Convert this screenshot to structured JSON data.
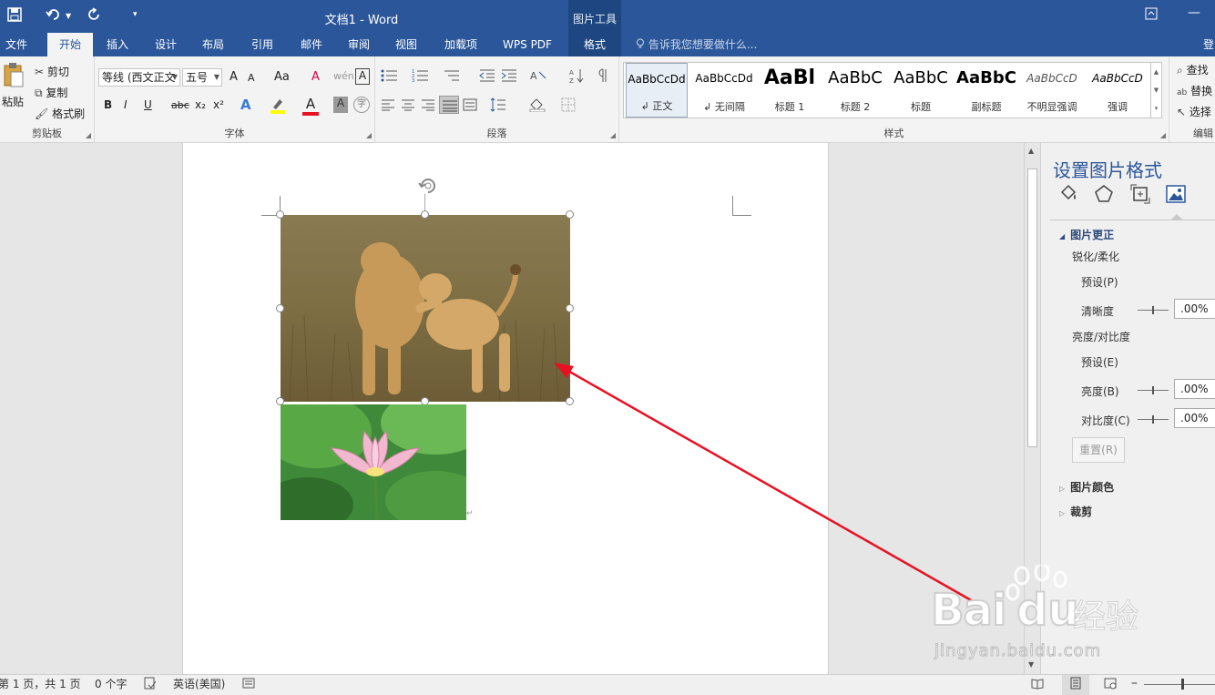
{
  "window": {
    "title": "文档1 - Word",
    "context_title": "图片工具",
    "restore_icon": "ribbon-display-icon",
    "minimize_glyph": "—"
  },
  "tabs": [
    "文件",
    "开始",
    "插入",
    "设计",
    "布局",
    "引用",
    "邮件",
    "审阅",
    "视图",
    "加载项",
    "WPS PDF",
    "格式"
  ],
  "active_tab": "开始",
  "tell_me": "告诉我您想要做什么...",
  "signin_partial": "登",
  "ribbon": {
    "clipboard": {
      "label": "剪贴板",
      "paste": "粘贴",
      "cut": "剪切",
      "copy": "复制",
      "format_painter": "格式刷"
    },
    "font": {
      "label": "字体",
      "font_name": "等线 (西文正文",
      "font_size": "五号",
      "bold": "B",
      "italic": "I",
      "underline": "U",
      "strike": "abc",
      "subscript": "x₂",
      "superscript": "x²",
      "grow": "A",
      "shrink": "A",
      "case": "Aa",
      "clear_format": "A",
      "phonetic": "wén",
      "border_char": "A",
      "text_effect": "A",
      "font_color": "A",
      "shading": "A",
      "enclose": "字",
      "highlight_color": "#ffff00",
      "font_color_value": "#e81123"
    },
    "paragraph": {
      "label": "段落"
    },
    "styles": {
      "label": "样式",
      "items": [
        {
          "sample": "AaBbCcDd",
          "name": "↲ 正文"
        },
        {
          "sample": "AaBbCcDd",
          "name": "↲ 无间隔"
        },
        {
          "sample": "AaBl",
          "name": "标题 1"
        },
        {
          "sample": "AaBbC",
          "name": "标题 2"
        },
        {
          "sample": "AaBbC",
          "name": "标题"
        },
        {
          "sample": "AaBbC",
          "name": "副标题"
        },
        {
          "sample": "AaBbCcD",
          "name": "不明显强调"
        },
        {
          "sample": "AaBbCcD",
          "name": "强调"
        }
      ]
    },
    "editing": {
      "label": "编辑",
      "find": "查找",
      "replace": "替换",
      "select": "选择"
    }
  },
  "pane": {
    "title": "设置图片格式",
    "tabs": [
      "fill-line-icon",
      "effects-icon",
      "layout-size-icon",
      "picture-icon"
    ],
    "section_correction": "图片更正",
    "sharpen_soften": "锐化/柔化",
    "preset1": "预设(P)",
    "sharpness": "清晰度",
    "sharpness_value": ".00%",
    "brightness_contrast": "亮度/对比度",
    "preset2": "预设(E)",
    "brightness": "亮度(B)",
    "brightness_value": ".00%",
    "contrast": "对比度(C)",
    "contrast_value": ".00%",
    "reset": "重置(R)",
    "section_color": "图片颜色",
    "section_crop": "裁剪"
  },
  "status": {
    "page": "第 1 页，共 1 页",
    "words": "0 个字",
    "language": "英语(美国)"
  },
  "watermark": {
    "brand": "Bai",
    "brand2": "du",
    "jingyan": "经验",
    "url": "jingyan.baidu.com"
  },
  "colors": {
    "title_bar": "#2b579a",
    "context_tab": "#1e4781",
    "arrow": "#e81123"
  }
}
